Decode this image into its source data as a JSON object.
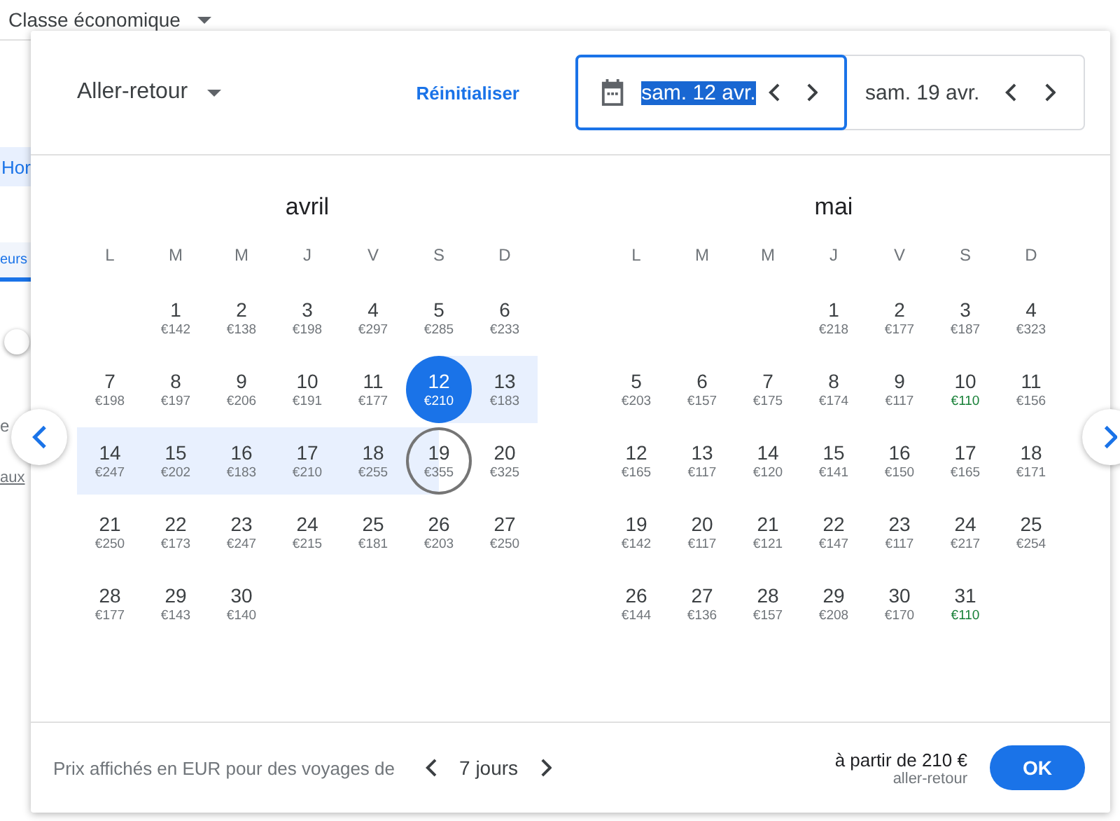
{
  "page": {
    "cabin_class": "Classe économique",
    "fragments": [
      {
        "kind": "tab",
        "text": "Hor"
      },
      {
        "kind": "tab_underlined",
        "text": "eurs"
      },
      {
        "kind": "toggle",
        "on": false
      },
      {
        "kind": "text",
        "text": "e"
      },
      {
        "kind": "link",
        "text": "aux"
      }
    ]
  },
  "dialog": {
    "trip_type": "Aller-retour",
    "reset": "Réinitialiser",
    "dates": [
      {
        "label": "sam. 12 avr.",
        "selected": true
      },
      {
        "label": "sam. 19 avr.",
        "selected": false
      }
    ],
    "months": [
      {
        "name": "avril",
        "weekdays": [
          "L",
          "M",
          "M",
          "J",
          "V",
          "S",
          "D"
        ],
        "weeks": [
          [
            {
              "day": "1",
              "price": "€142",
              "kind": "plain",
              "cheap": false
            },
            {
              "day": "2",
              "price": "€138",
              "kind": "plain",
              "cheap": false
            },
            {
              "day": "3",
              "price": "€198",
              "kind": "plain",
              "cheap": false
            },
            {
              "day": "4",
              "price": "€297",
              "kind": "plain",
              "cheap": false
            },
            {
              "day": "5",
              "price": "€285",
              "kind": "plain",
              "cheap": false
            },
            {
              "day": "6",
              "price": "€233",
              "kind": "plain",
              "cheap": false
            }
          ],
          [
            {
              "day": "7",
              "price": "€198",
              "kind": "plain",
              "cheap": false
            },
            {
              "day": "8",
              "price": "€197",
              "kind": "plain",
              "cheap": false
            },
            {
              "day": "9",
              "price": "€206",
              "kind": "plain",
              "cheap": false
            },
            {
              "day": "10",
              "price": "€191",
              "kind": "plain",
              "cheap": false
            },
            {
              "day": "11",
              "price": "€177",
              "kind": "plain",
              "cheap": false
            },
            {
              "day": "12",
              "price": "€210",
              "kind": "start",
              "cheap": false
            },
            {
              "day": "13",
              "price": "€183",
              "kind": "in_range",
              "cheap": false
            }
          ],
          [
            {
              "day": "14",
              "price": "€247",
              "kind": "in_range",
              "cheap": false
            },
            {
              "day": "15",
              "price": "€202",
              "kind": "in_range",
              "cheap": false
            },
            {
              "day": "16",
              "price": "€183",
              "kind": "in_range",
              "cheap": false
            },
            {
              "day": "17",
              "price": "€210",
              "kind": "in_range",
              "cheap": false
            },
            {
              "day": "18",
              "price": "€255",
              "kind": "in_range",
              "cheap": false
            },
            {
              "day": "19",
              "price": "€355",
              "kind": "end",
              "cheap": false
            },
            {
              "day": "20",
              "price": "€325",
              "kind": "plain",
              "cheap": false
            }
          ],
          [
            {
              "day": "21",
              "price": "€250",
              "kind": "plain",
              "cheap": false
            },
            {
              "day": "22",
              "price": "€173",
              "kind": "plain",
              "cheap": false
            },
            {
              "day": "23",
              "price": "€247",
              "kind": "plain",
              "cheap": false
            },
            {
              "day": "24",
              "price": "€215",
              "kind": "plain",
              "cheap": false
            },
            {
              "day": "25",
              "price": "€181",
              "kind": "plain",
              "cheap": false
            },
            {
              "day": "26",
              "price": "€203",
              "kind": "plain",
              "cheap": false
            },
            {
              "day": "27",
              "price": "€250",
              "kind": "plain",
              "cheap": false
            }
          ],
          [
            {
              "day": "28",
              "price": "€177",
              "kind": "plain",
              "cheap": false
            },
            {
              "day": "29",
              "price": "€143",
              "kind": "plain",
              "cheap": false
            },
            {
              "day": "30",
              "price": "€140",
              "kind": "plain",
              "cheap": false
            }
          ]
        ]
      },
      {
        "name": "mai",
        "weekdays": [
          "L",
          "M",
          "M",
          "J",
          "V",
          "S",
          "D"
        ],
        "weeks": [
          [
            {
              "day": "1",
              "price": "€218",
              "kind": "plain",
              "cheap": false
            },
            {
              "day": "2",
              "price": "€177",
              "kind": "plain",
              "cheap": false
            },
            {
              "day": "3",
              "price": "€187",
              "kind": "plain",
              "cheap": false
            },
            {
              "day": "4",
              "price": "€323",
              "kind": "plain",
              "cheap": false
            }
          ],
          [
            {
              "day": "5",
              "price": "€203",
              "kind": "plain",
              "cheap": false
            },
            {
              "day": "6",
              "price": "€157",
              "kind": "plain",
              "cheap": false
            },
            {
              "day": "7",
              "price": "€175",
              "kind": "plain",
              "cheap": false
            },
            {
              "day": "8",
              "price": "€174",
              "kind": "plain",
              "cheap": false
            },
            {
              "day": "9",
              "price": "€117",
              "kind": "plain",
              "cheap": false
            },
            {
              "day": "10",
              "price": "€110",
              "kind": "plain",
              "cheap": true
            },
            {
              "day": "11",
              "price": "€156",
              "kind": "plain",
              "cheap": false
            }
          ],
          [
            {
              "day": "12",
              "price": "€165",
              "kind": "plain",
              "cheap": false
            },
            {
              "day": "13",
              "price": "€117",
              "kind": "plain",
              "cheap": false
            },
            {
              "day": "14",
              "price": "€120",
              "kind": "plain",
              "cheap": false
            },
            {
              "day": "15",
              "price": "€141",
              "kind": "plain",
              "cheap": false
            },
            {
              "day": "16",
              "price": "€150",
              "kind": "plain",
              "cheap": false
            },
            {
              "day": "17",
              "price": "€165",
              "kind": "plain",
              "cheap": false
            },
            {
              "day": "18",
              "price": "€171",
              "kind": "plain",
              "cheap": false
            }
          ],
          [
            {
              "day": "19",
              "price": "€142",
              "kind": "plain",
              "cheap": false
            },
            {
              "day": "20",
              "price": "€117",
              "kind": "plain",
              "cheap": false
            },
            {
              "day": "21",
              "price": "€121",
              "kind": "plain",
              "cheap": false
            },
            {
              "day": "22",
              "price": "€147",
              "kind": "plain",
              "cheap": false
            },
            {
              "day": "23",
              "price": "€117",
              "kind": "plain",
              "cheap": false
            },
            {
              "day": "24",
              "price": "€217",
              "kind": "plain",
              "cheap": false
            },
            {
              "day": "25",
              "price": "€254",
              "kind": "plain",
              "cheap": false
            }
          ],
          [
            {
              "day": "26",
              "price": "€144",
              "kind": "plain",
              "cheap": false
            },
            {
              "day": "27",
              "price": "€136",
              "kind": "plain",
              "cheap": false
            },
            {
              "day": "28",
              "price": "€157",
              "kind": "plain",
              "cheap": false
            },
            {
              "day": "29",
              "price": "€208",
              "kind": "plain",
              "cheap": false
            },
            {
              "day": "30",
              "price": "€170",
              "kind": "plain",
              "cheap": false
            },
            {
              "day": "31",
              "price": "€110",
              "kind": "plain",
              "cheap": true
            }
          ]
        ]
      }
    ],
    "footer": {
      "note": "Prix affichés en EUR pour des voyages de",
      "duration": "7 jours",
      "price": "à partir de 210 €",
      "price_note": "aller-retour",
      "ok": "OK"
    }
  }
}
